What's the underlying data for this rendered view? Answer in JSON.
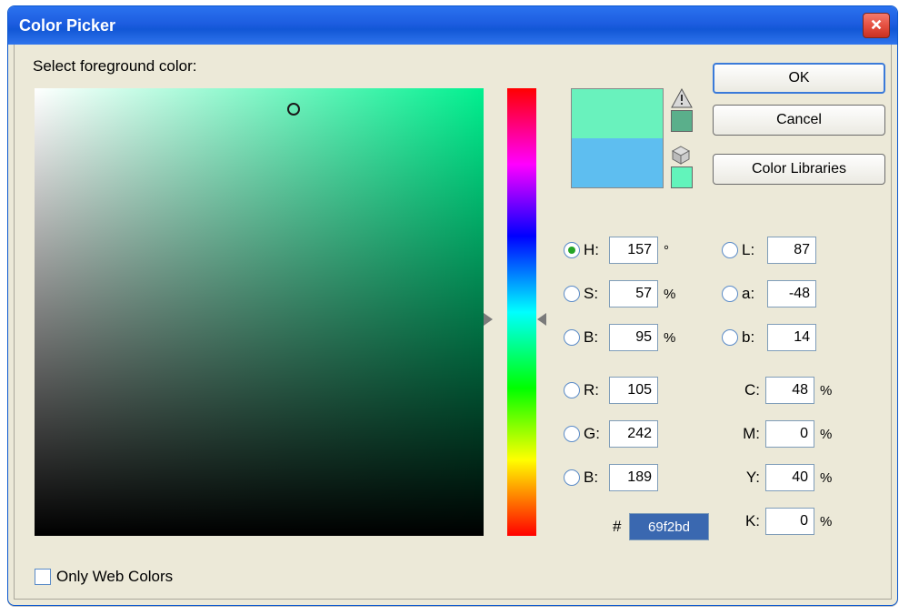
{
  "window": {
    "title": "Color Picker"
  },
  "heading": "Select foreground color:",
  "buttons": {
    "ok": "OK",
    "cancel": "Cancel",
    "libraries": "Color Libraries"
  },
  "swatches": {
    "new_color": "#69f2bd",
    "old_color": "#5ebef0"
  },
  "fields": {
    "h": {
      "label": "H:",
      "value": "157",
      "unit": "°"
    },
    "s": {
      "label": "S:",
      "value": "57",
      "unit": "%"
    },
    "v": {
      "label": "B:",
      "value": "95",
      "unit": "%"
    },
    "r": {
      "label": "R:",
      "value": "105",
      "unit": ""
    },
    "g": {
      "label": "G:",
      "value": "242",
      "unit": ""
    },
    "b": {
      "label": "B:",
      "value": "189",
      "unit": ""
    },
    "l_l": {
      "label": "L:",
      "value": "87",
      "unit": ""
    },
    "l_a": {
      "label": "a:",
      "value": "-48",
      "unit": ""
    },
    "l_b": {
      "label": "b:",
      "value": "14",
      "unit": ""
    },
    "c": {
      "label": "C:",
      "value": "48",
      "unit": "%"
    },
    "m": {
      "label": "M:",
      "value": "0",
      "unit": "%"
    },
    "y": {
      "label": "Y:",
      "value": "40",
      "unit": "%"
    },
    "k": {
      "label": "K:",
      "value": "0",
      "unit": "%"
    }
  },
  "hex": {
    "label": "#",
    "value": "69f2bd"
  },
  "web_only": "Only Web Colors"
}
